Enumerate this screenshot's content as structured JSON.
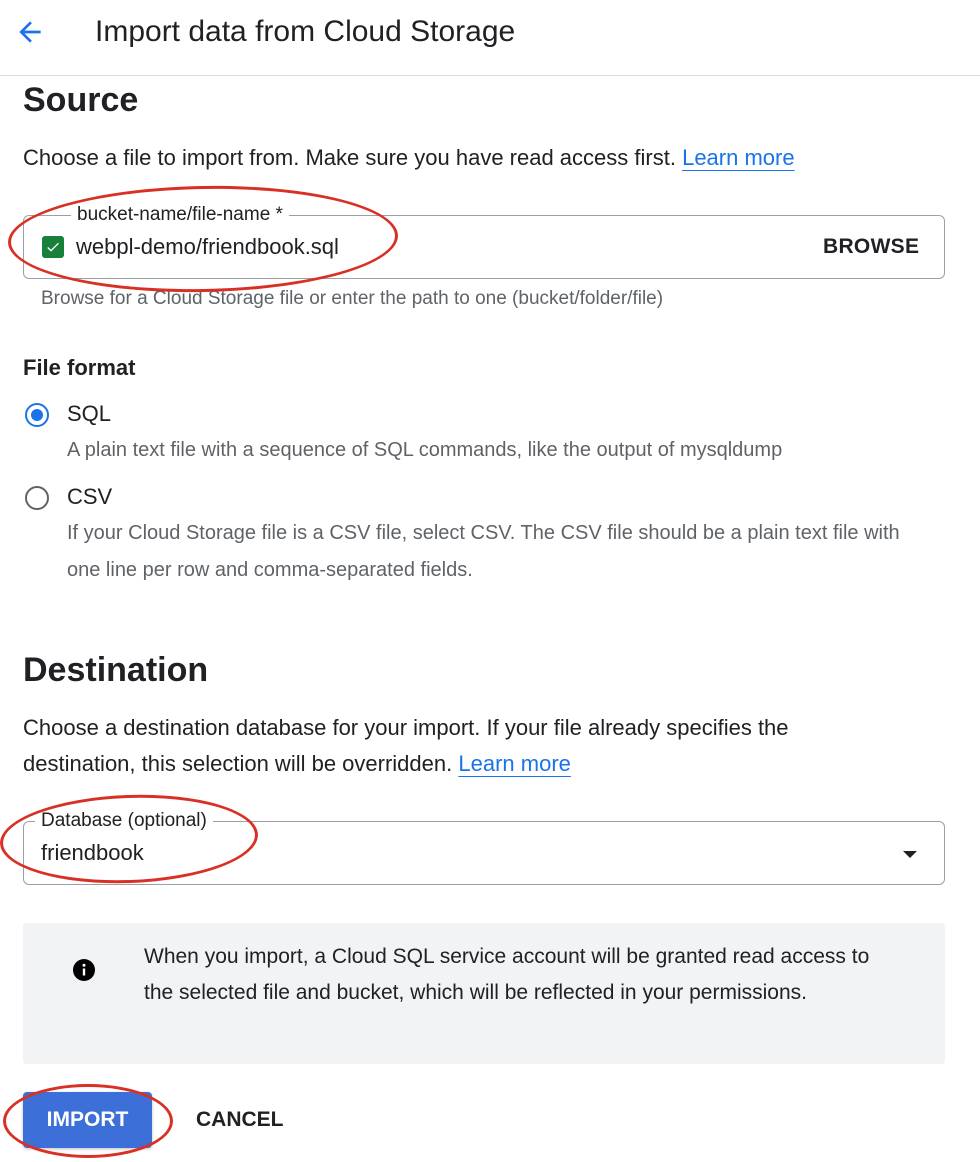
{
  "header": {
    "title": "Import data from Cloud Storage",
    "back_icon": "arrow-back-icon"
  },
  "colors": {
    "accent": "#1a73e8",
    "import_button": "#3c6fd8",
    "success_check": "#188038",
    "annotation": "#d93025"
  },
  "source": {
    "heading": "Source",
    "description": "Choose a file to import from. Make sure you have read access first.",
    "learn_more": "Learn more",
    "file_field": {
      "label": "bucket-name/file-name *",
      "value": "webpl-demo/friendbook.sql",
      "status_icon": "check-box-icon",
      "browse_label": "BROWSE",
      "hint": "Browse for a Cloud Storage file or enter the path to one (bucket/folder/file)"
    }
  },
  "file_format": {
    "label": "File format",
    "options": [
      {
        "label": "SQL",
        "description": "A plain text file with a sequence of SQL commands, like the output of mysqldump",
        "selected": true
      },
      {
        "label": "CSV",
        "description": "If your Cloud Storage file is a CSV file, select CSV. The CSV file should be a plain text file with one line per row and comma-separated fields.",
        "selected": false
      }
    ]
  },
  "destination": {
    "heading": "Destination",
    "description": "Choose a destination database for your import. If your file already specifies the destination, this selection will be overridden.",
    "learn_more": "Learn more",
    "database_field": {
      "label": "Database (optional)",
      "value": "friendbook",
      "dropdown_icon": "arrow-drop-down-icon"
    }
  },
  "info": {
    "icon": "info-icon",
    "text": "When you import, a Cloud SQL service account will be granted read access to the selected file and bucket, which will be reflected in your permissions."
  },
  "actions": {
    "import_label": "IMPORT",
    "cancel_label": "CANCEL"
  }
}
